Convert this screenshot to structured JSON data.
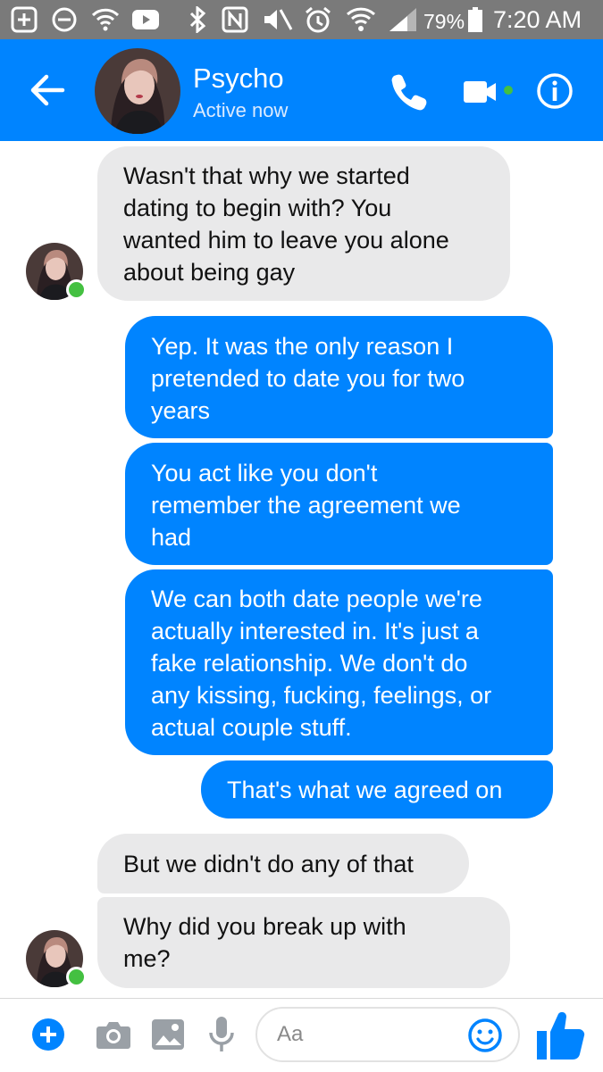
{
  "status_bar": {
    "battery": "79%",
    "time": "7:20 AM"
  },
  "header": {
    "contact_name": "Psycho",
    "contact_status": "Active now",
    "icons": [
      "back-arrow-icon",
      "phone-icon",
      "video-camera-icon",
      "info-icon"
    ]
  },
  "messages": [
    {
      "sender": "them",
      "text": "Wasn't that why we started\ndating to begin with? You\nwanted him to leave you alone\nabout being gay"
    },
    {
      "sender": "me",
      "text": "Yep. It was the only reason I\npretended to date you for two\nyears"
    },
    {
      "sender": "me",
      "text": "You act like you don't\nremember the agreement we\nhad"
    },
    {
      "sender": "me",
      "text": "We can both date people we're\nactually interested in. It's just a\nfake relationship. We don't do\nany kissing, fucking, feelings, or\nactual couple stuff."
    },
    {
      "sender": "me",
      "text": "That's what we agreed on"
    },
    {
      "sender": "them",
      "text": "But we didn't do any of that"
    },
    {
      "sender": "them",
      "text": "Why did you break up with\nme?"
    }
  ],
  "composer": {
    "placeholder": "Aa",
    "icons": [
      "plus-icon",
      "camera-icon",
      "gallery-icon",
      "microphone-icon",
      "emoji-icon",
      "thumbs-up-icon"
    ]
  },
  "colors": {
    "brand_blue": "#0084ff",
    "incoming_bubble": "#e9e9ea",
    "online_green": "#44c041",
    "status_bar": "#7a7a7a"
  }
}
